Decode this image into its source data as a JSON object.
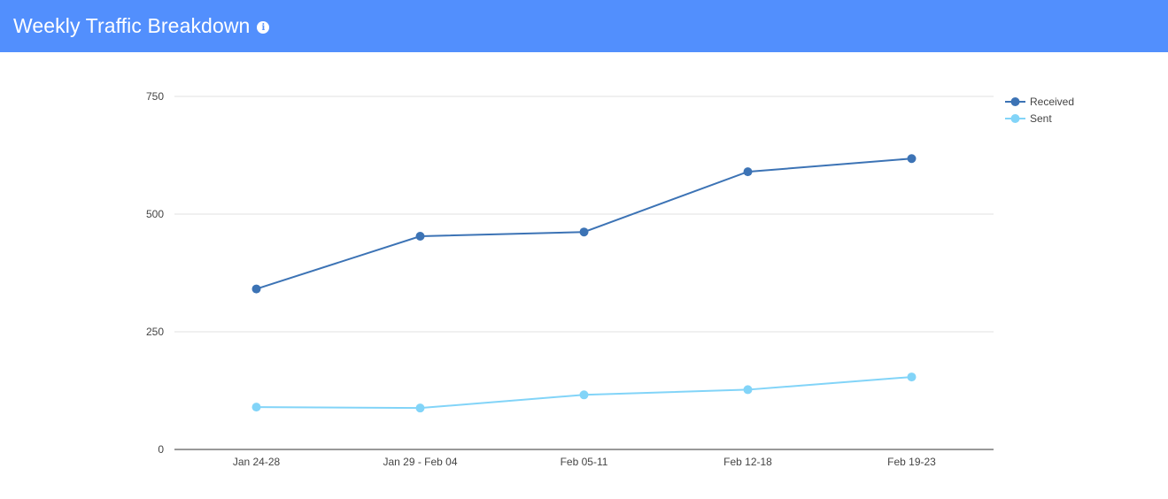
{
  "header": {
    "title": "Weekly Traffic Breakdown",
    "info_icon": "info-icon",
    "background_color": "#528ffd"
  },
  "chart_data": {
    "type": "line",
    "title": "Weekly Traffic Breakdown",
    "xlabel": "",
    "ylabel": "",
    "categories": [
      "Jan 24-28",
      "Jan 29 - Feb 04",
      "Feb 05-11",
      "Feb 12-18",
      "Feb 19-23"
    ],
    "ylim": [
      0,
      750
    ],
    "yticks": [
      0,
      250,
      500,
      750
    ],
    "grid": true,
    "legend_position": "top-right",
    "series": [
      {
        "name": "Received",
        "color": "#3c73b5",
        "values": [
          341,
          453,
          462,
          590,
          618
        ]
      },
      {
        "name": "Sent",
        "color": "#82d4f8",
        "values": [
          90,
          88,
          116,
          127,
          154
        ]
      }
    ]
  }
}
